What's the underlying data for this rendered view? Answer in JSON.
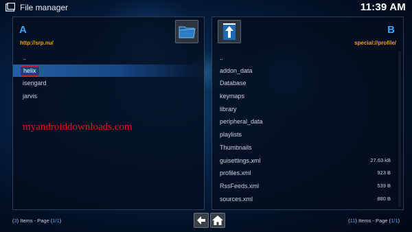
{
  "window": {
    "title": "File manager",
    "clock": "11:39 AM"
  },
  "left_panel": {
    "letter": "A",
    "path": "http://srp.nu/",
    "items": [
      {
        "name": ".."
      },
      {
        "name": "helix",
        "selected": true
      },
      {
        "name": "isengard"
      },
      {
        "name": "jarvis"
      }
    ],
    "footer": {
      "count": "3",
      "items_label": " Items - Page (",
      "page": "1/1",
      "close": ")"
    }
  },
  "right_panel": {
    "letter": "B",
    "path": "special://profile/",
    "items": [
      {
        "name": "..",
        "size": ""
      },
      {
        "name": "addon_data",
        "size": ""
      },
      {
        "name": "Database",
        "size": ""
      },
      {
        "name": "keymaps",
        "size": ""
      },
      {
        "name": "library",
        "size": ""
      },
      {
        "name": "peripheral_data",
        "size": ""
      },
      {
        "name": "playlists",
        "size": ""
      },
      {
        "name": "Thumbnails",
        "size": ""
      },
      {
        "name": "guisettings.xml",
        "size": "27.63 kB"
      },
      {
        "name": "profiles.xml",
        "size": "923 B"
      },
      {
        "name": "RssFeeds.xml",
        "size": "539 B"
      },
      {
        "name": "sources.xml",
        "size": "880 B"
      }
    ],
    "footer": {
      "count": "11",
      "items_label": " Items - Page (",
      "page": "1/1",
      "close": ")"
    }
  },
  "watermark": "myandroiddownloads.com",
  "icons": {
    "app": "file-manager-icon",
    "folder": "folder-icon",
    "up": "up-arrow-icon",
    "back": "back-arrow-icon",
    "home": "home-icon"
  },
  "colors": {
    "accent": "#3aa8ff",
    "path": "#f0a020",
    "selection_border": "#d22828",
    "watermark": "#e01818"
  }
}
